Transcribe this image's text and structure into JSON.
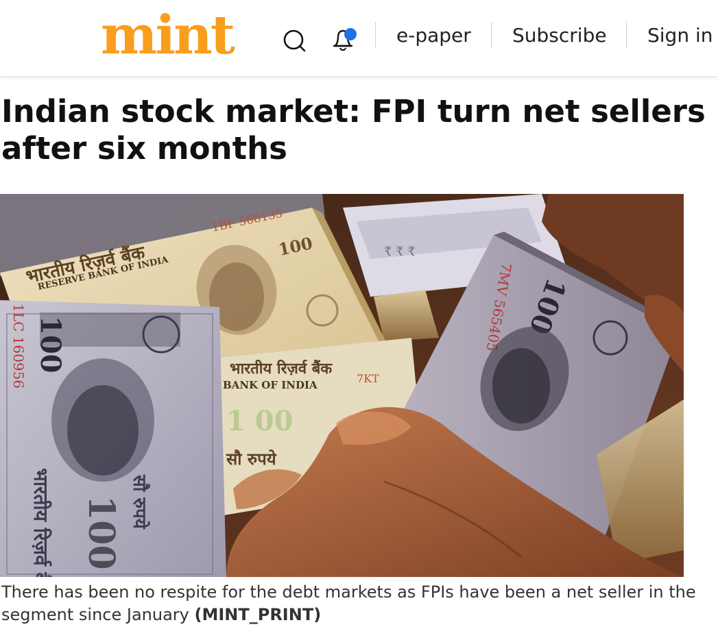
{
  "header": {
    "logo_text": "mint",
    "brand_color": "#f99d1c",
    "icons": [
      "search-icon",
      "notification-bell-icon"
    ],
    "notification_dot_color": "#1a73e8",
    "nav": {
      "epaper": "e-paper",
      "subscribe": "Subscribe",
      "signin": "Sign in"
    }
  },
  "article": {
    "headline": "Indian stock market: FPI turn net sellers after six months",
    "image": {
      "caption": "There has been no respite for the debt markets as FPIs have been a net seller in the segment since January",
      "credit": "(MINT_PRINT)",
      "banknote_text": {
        "denomination": "100",
        "bank_hindi": "भारतीय रिज़र्व बैंक",
        "bank_english": "RESERVE BANK OF INDIA",
        "bank_english_partial": "BANK OF INDIA",
        "serial_left": "1LC 160956",
        "serial_right": "7MV 565405",
        "serial_top": "1BF 568135",
        "rupees_hindi": "सौ रुपये",
        "code_fragment": "7KT"
      }
    }
  }
}
